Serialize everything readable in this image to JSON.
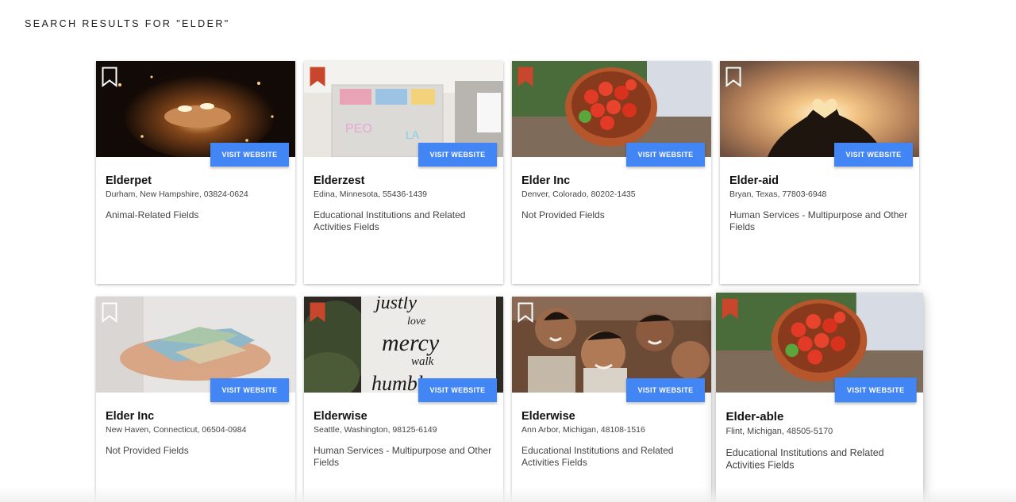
{
  "search": {
    "heading": "SEARCH RESULTS FOR \"ELDER\""
  },
  "colors": {
    "accent": "#4285f4",
    "bookmark_saved": "#c8462b",
    "bookmark_outline": "#ffffff"
  },
  "cards": [
    {
      "name": "Elderpet",
      "location": "Durham, New Hampshire, 03824-0624",
      "category": "Animal-Related Fields",
      "button": "VISIT WEBSITE",
      "saved": false,
      "image": "candles"
    },
    {
      "name": "Elderzest",
      "location": "Edina, Minnesota, 55436-1439",
      "category": "Educational Institutions and Related Activities Fields",
      "button": "VISIT WEBSITE",
      "saved": true,
      "image": "donation-boxes"
    },
    {
      "name": "Elder Inc",
      "location": "Denver, Colorado, 80202-1435",
      "category": "Not Provided Fields",
      "button": "VISIT WEBSITE",
      "saved": true,
      "image": "tomato-bowl"
    },
    {
      "name": "Elder-aid",
      "location": "Bryan, Texas, 77803-6948",
      "category": "Human Services - Multipurpose and Other Fields",
      "button": "VISIT WEBSITE",
      "saved": false,
      "image": "heart-hands-sunset"
    },
    {
      "name": "Elder Inc",
      "location": "New Haven, Connecticut, 06504-0984",
      "category": "Not Provided Fields",
      "button": "VISIT WEBSITE",
      "saved": false,
      "image": "money-hands"
    },
    {
      "name": "Elderwise",
      "location": "Seattle, Washington, 98125-6149",
      "category": "Human Services - Multipurpose and Other Fields",
      "button": "VISIT WEBSITE",
      "saved": true,
      "image": "love-mercy-sign"
    },
    {
      "name": "Elderwise",
      "location": "Ann Arbor, Michigan, 48108-1516",
      "category": "Educational Institutions and Related Activities Fields",
      "button": "VISIT WEBSITE",
      "saved": false,
      "image": "smiling-children"
    },
    {
      "name": "Elder-able",
      "location": "Flint, Michigan, 48505-5170",
      "category": "Educational Institutions and Related Activities Fields",
      "button": "VISIT WEBSITE",
      "saved": true,
      "image": "tomato-bowl"
    }
  ]
}
